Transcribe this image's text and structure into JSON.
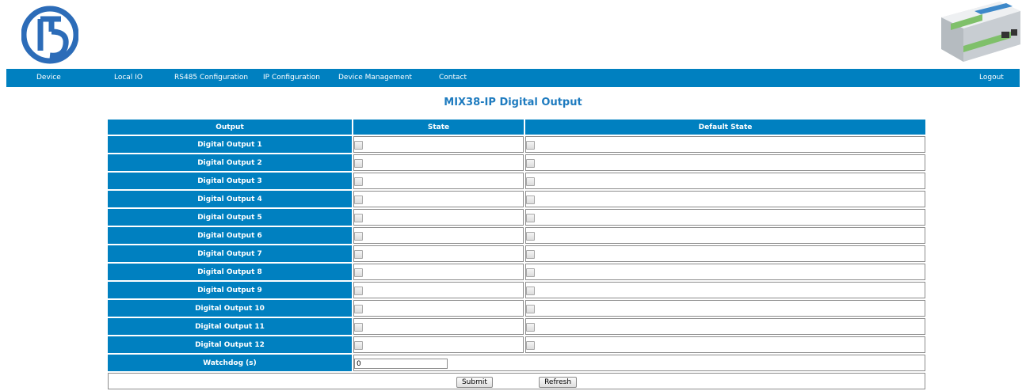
{
  "colors": {
    "accent": "#0080c0",
    "title": "#1e7bbf",
    "logo": "#2c6cb8"
  },
  "brand": {
    "logo_text": "G5",
    "device_image": "mix38-ip-device"
  },
  "nav": {
    "device": "Device",
    "local_io": "Local IO",
    "rs485": "RS485 Configuration",
    "ip_config": "IP Configuration",
    "device_mgmt": "Device Management",
    "contact": "Contact",
    "logout": "Logout"
  },
  "page": {
    "title": "MIX38-IP Digital Output"
  },
  "table": {
    "headers": {
      "output": "Output",
      "state": "State",
      "default_state": "Default State"
    },
    "rows": [
      {
        "label": "Digital Output 1",
        "state": false,
        "default_state": false
      },
      {
        "label": "Digital Output 2",
        "state": false,
        "default_state": false
      },
      {
        "label": "Digital Output 3",
        "state": false,
        "default_state": false
      },
      {
        "label": "Digital Output 4",
        "state": false,
        "default_state": false
      },
      {
        "label": "Digital Output 5",
        "state": false,
        "default_state": false
      },
      {
        "label": "Digital Output 6",
        "state": false,
        "default_state": false
      },
      {
        "label": "Digital Output 7",
        "state": false,
        "default_state": false
      },
      {
        "label": "Digital Output 8",
        "state": false,
        "default_state": false
      },
      {
        "label": "Digital Output 9",
        "state": false,
        "default_state": false
      },
      {
        "label": "Digital Output 10",
        "state": false,
        "default_state": false
      },
      {
        "label": "Digital Output 11",
        "state": false,
        "default_state": false
      },
      {
        "label": "Digital Output 12",
        "state": false,
        "default_state": false
      }
    ],
    "watchdog": {
      "label": "Watchdog (s)",
      "value": "0"
    }
  },
  "buttons": {
    "submit": "Submit",
    "refresh": "Refresh"
  }
}
